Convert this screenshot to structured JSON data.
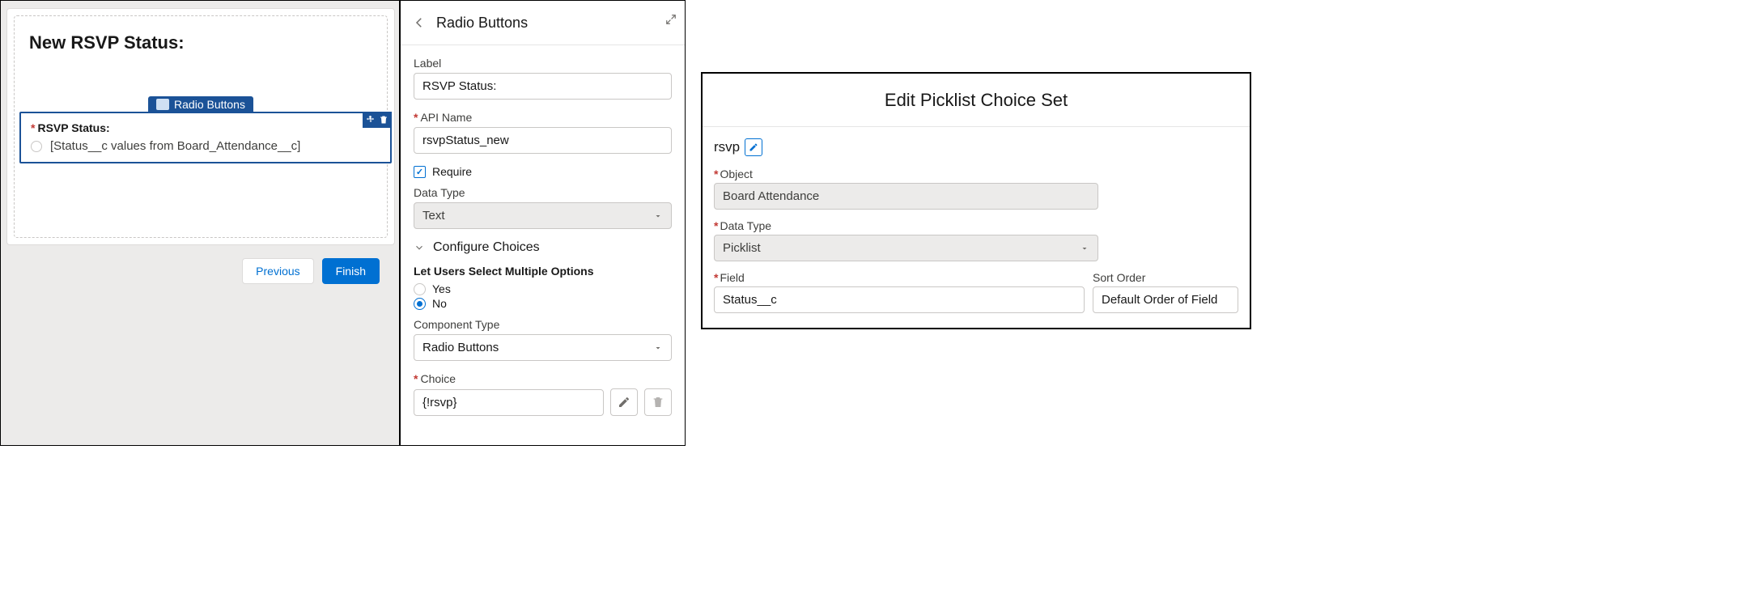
{
  "left": {
    "screen_title": "New RSVP Status:",
    "component_chip": "Radio Buttons",
    "field_label": "RSVP Status:",
    "placeholder_value": "[Status__c values from Board_Attendance__c]",
    "btn_previous": "Previous",
    "btn_finish": "Finish"
  },
  "mid": {
    "header_title": "Radio Buttons",
    "label_label": "Label",
    "label_value": "RSVP Status:",
    "api_label": "API Name",
    "api_value": "rsvpStatus_new",
    "require_label": "Require",
    "datatype_label": "Data Type",
    "datatype_value": "Text",
    "configure_label": "Configure Choices",
    "multi_label": "Let Users Select Multiple Options",
    "opt_yes": "Yes",
    "opt_no": "No",
    "component_type_label": "Component Type",
    "component_type_value": "Radio Buttons",
    "choice_label": "Choice",
    "choice_value": "{!rsvp}"
  },
  "right": {
    "header_title": "Edit Picklist Choice Set",
    "api_name": "rsvp",
    "object_label": "Object",
    "object_value": "Board Attendance",
    "datatype_label": "Data Type",
    "datatype_value": "Picklist",
    "field_label": "Field",
    "field_value": "Status__c",
    "sortorder_label": "Sort Order",
    "sortorder_value": "Default Order of Field"
  }
}
